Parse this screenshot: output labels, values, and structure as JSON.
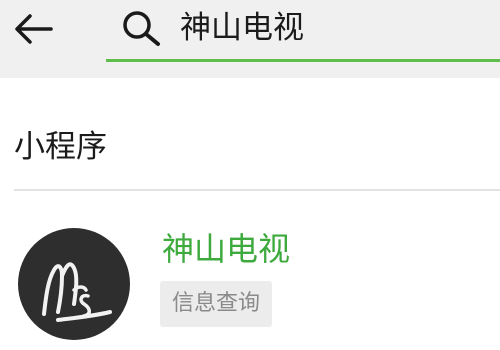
{
  "header": {
    "back_icon": "arrow-left-icon",
    "search_icon": "search-icon",
    "search_query": "神山电视",
    "accent_color": "#5fbd4c"
  },
  "section": {
    "title": "小程序"
  },
  "results": [
    {
      "name": "神山电视",
      "tag": "信息查询",
      "avatar_icon": "mountain-logo-icon",
      "name_color": "#3eaa3e"
    }
  ]
}
